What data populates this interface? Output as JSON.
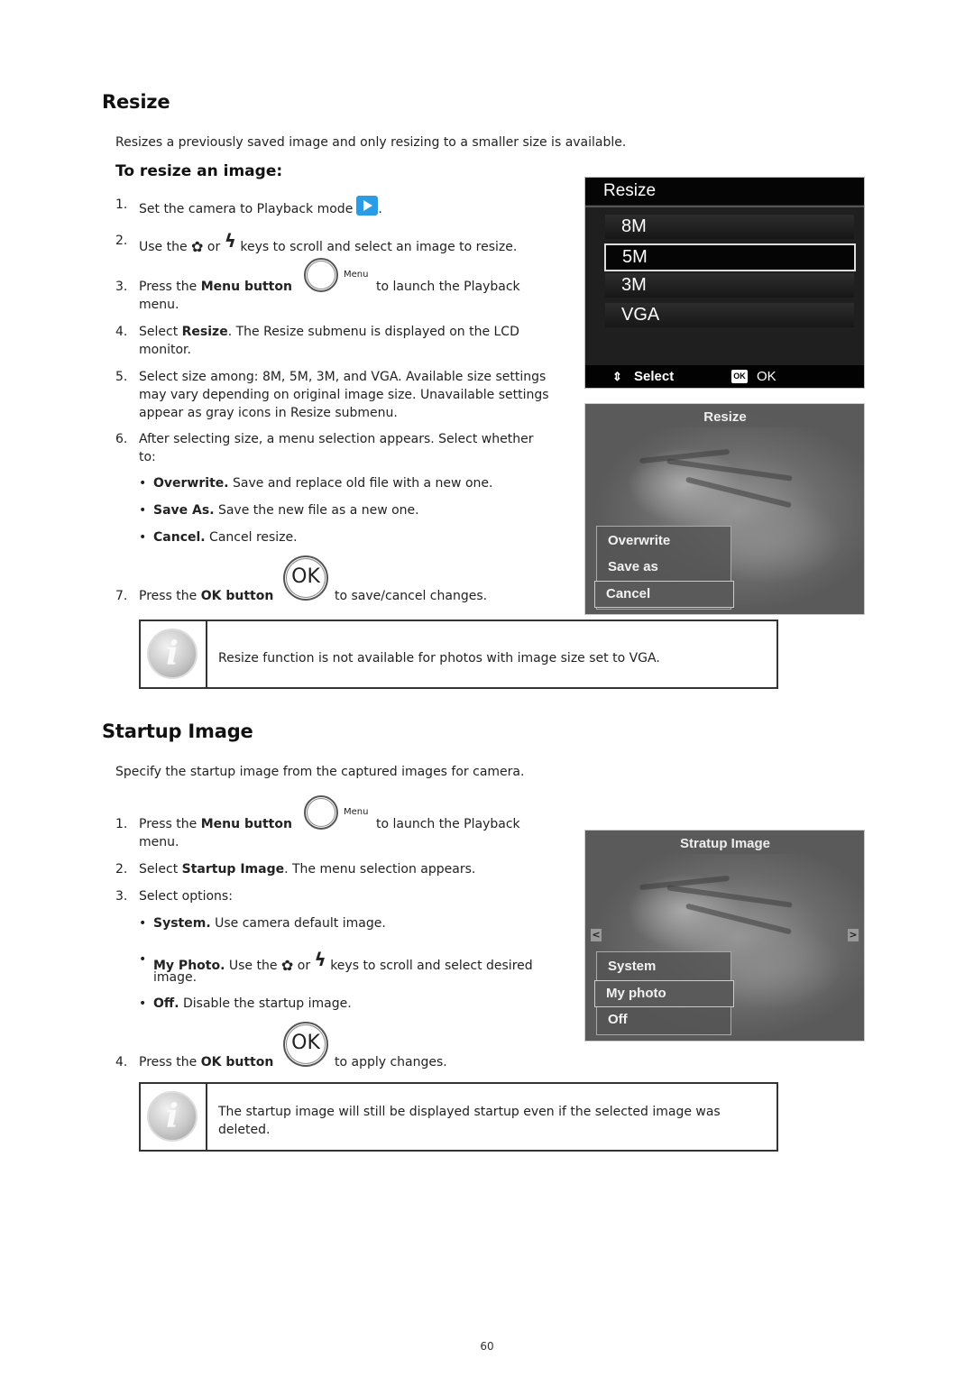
{
  "page_number": "60",
  "resize": {
    "heading": "Resize",
    "intro": "Resizes a previously saved image and only resizing to a smaller size is available.",
    "subheading": "To resize an image:",
    "steps": [
      {
        "num": "1.",
        "pre": "Set the camera to Playback mode",
        "post": "."
      },
      {
        "num": "2.",
        "pre": "Use the",
        "mid": "or",
        "post": "keys to scroll and select an image to resize."
      },
      {
        "num": "3.",
        "pre": "Press the ",
        "bold": "Menu button",
        "post": "to launch the Playback",
        "line2": "menu.",
        "button_label": "Menu"
      },
      {
        "num": "4.",
        "pre": "Select ",
        "bold": "Resize",
        "post": ". The Resize submenu is displayed on the LCD",
        "line2": "monitor."
      },
      {
        "num": "5.",
        "line1": "Select size among: 8M, 5M, 3M, and VGA. Available size settings",
        "line2": "may vary depending on original image size. Unavailable settings",
        "line3": "appear as gray icons in Resize submenu."
      },
      {
        "num": "6.",
        "line1": "After selecting size, a menu selection appears. Select whether",
        "line2": "to:"
      },
      {
        "num": "7.",
        "pre": "Press the ",
        "bold": "OK button",
        "post": "to save/cancel changes.",
        "button_label": "OK"
      }
    ],
    "options": [
      {
        "bold": "Overwrite.",
        "text": " Save and replace old file with a new one."
      },
      {
        "bold": "Save As.",
        "text": " Save the new file as a new one."
      },
      {
        "bold": "Cancel.",
        "text": " Cancel resize."
      }
    ],
    "lcd_menu": {
      "title": "Resize",
      "options": [
        "8M",
        "5M",
        "3M",
        "VGA"
      ],
      "selected": "5M",
      "footer_select": "Select",
      "footer_ok_badge": "OK",
      "footer_ok": "OK"
    },
    "lcd_popup": {
      "title": "Resize",
      "options": [
        "Overwrite",
        "Save as",
        "Cancel"
      ],
      "selected": "Cancel"
    },
    "note": "Resize function is not available for photos with image size set to VGA."
  },
  "startup": {
    "heading": "Startup Image",
    "intro": "Specify the startup image from the captured images for camera.",
    "steps": [
      {
        "num": "1.",
        "pre": "Press the ",
        "bold": "Menu button",
        "post": "to launch the Playback",
        "line2": "menu.",
        "button_label": "Menu"
      },
      {
        "num": "2.",
        "pre": "Select ",
        "bold": "Startup Image",
        "post": ". The menu selection appears."
      },
      {
        "num": "3.",
        "line1": "Select options:"
      },
      {
        "num": "4.",
        "pre": "Press the ",
        "bold": "OK button",
        "post": "to apply changes.",
        "button_label": "OK"
      }
    ],
    "options": [
      {
        "bold": "System.",
        "text": " Use camera default image."
      },
      {
        "bold": "My Photo.",
        "pre": " Use the",
        "mid": "or",
        "text": "keys to scroll and select desired",
        "line2": "image."
      },
      {
        "bold": "Off.",
        "text": " Disable the startup image."
      }
    ],
    "lcd_popup": {
      "title": "Stratup Image",
      "options": [
        "System",
        "My photo",
        "Off"
      ],
      "selected": "My photo",
      "prev_arrow": "<",
      "next_arrow": ">"
    },
    "note_line1": "The startup image will still be displayed startup even if the selected image was",
    "note_line2": "deleted."
  },
  "icons": {
    "macro": "✿",
    "flash": "ϟ",
    "bullet": "•",
    "info": "i",
    "updown": "⇕"
  }
}
